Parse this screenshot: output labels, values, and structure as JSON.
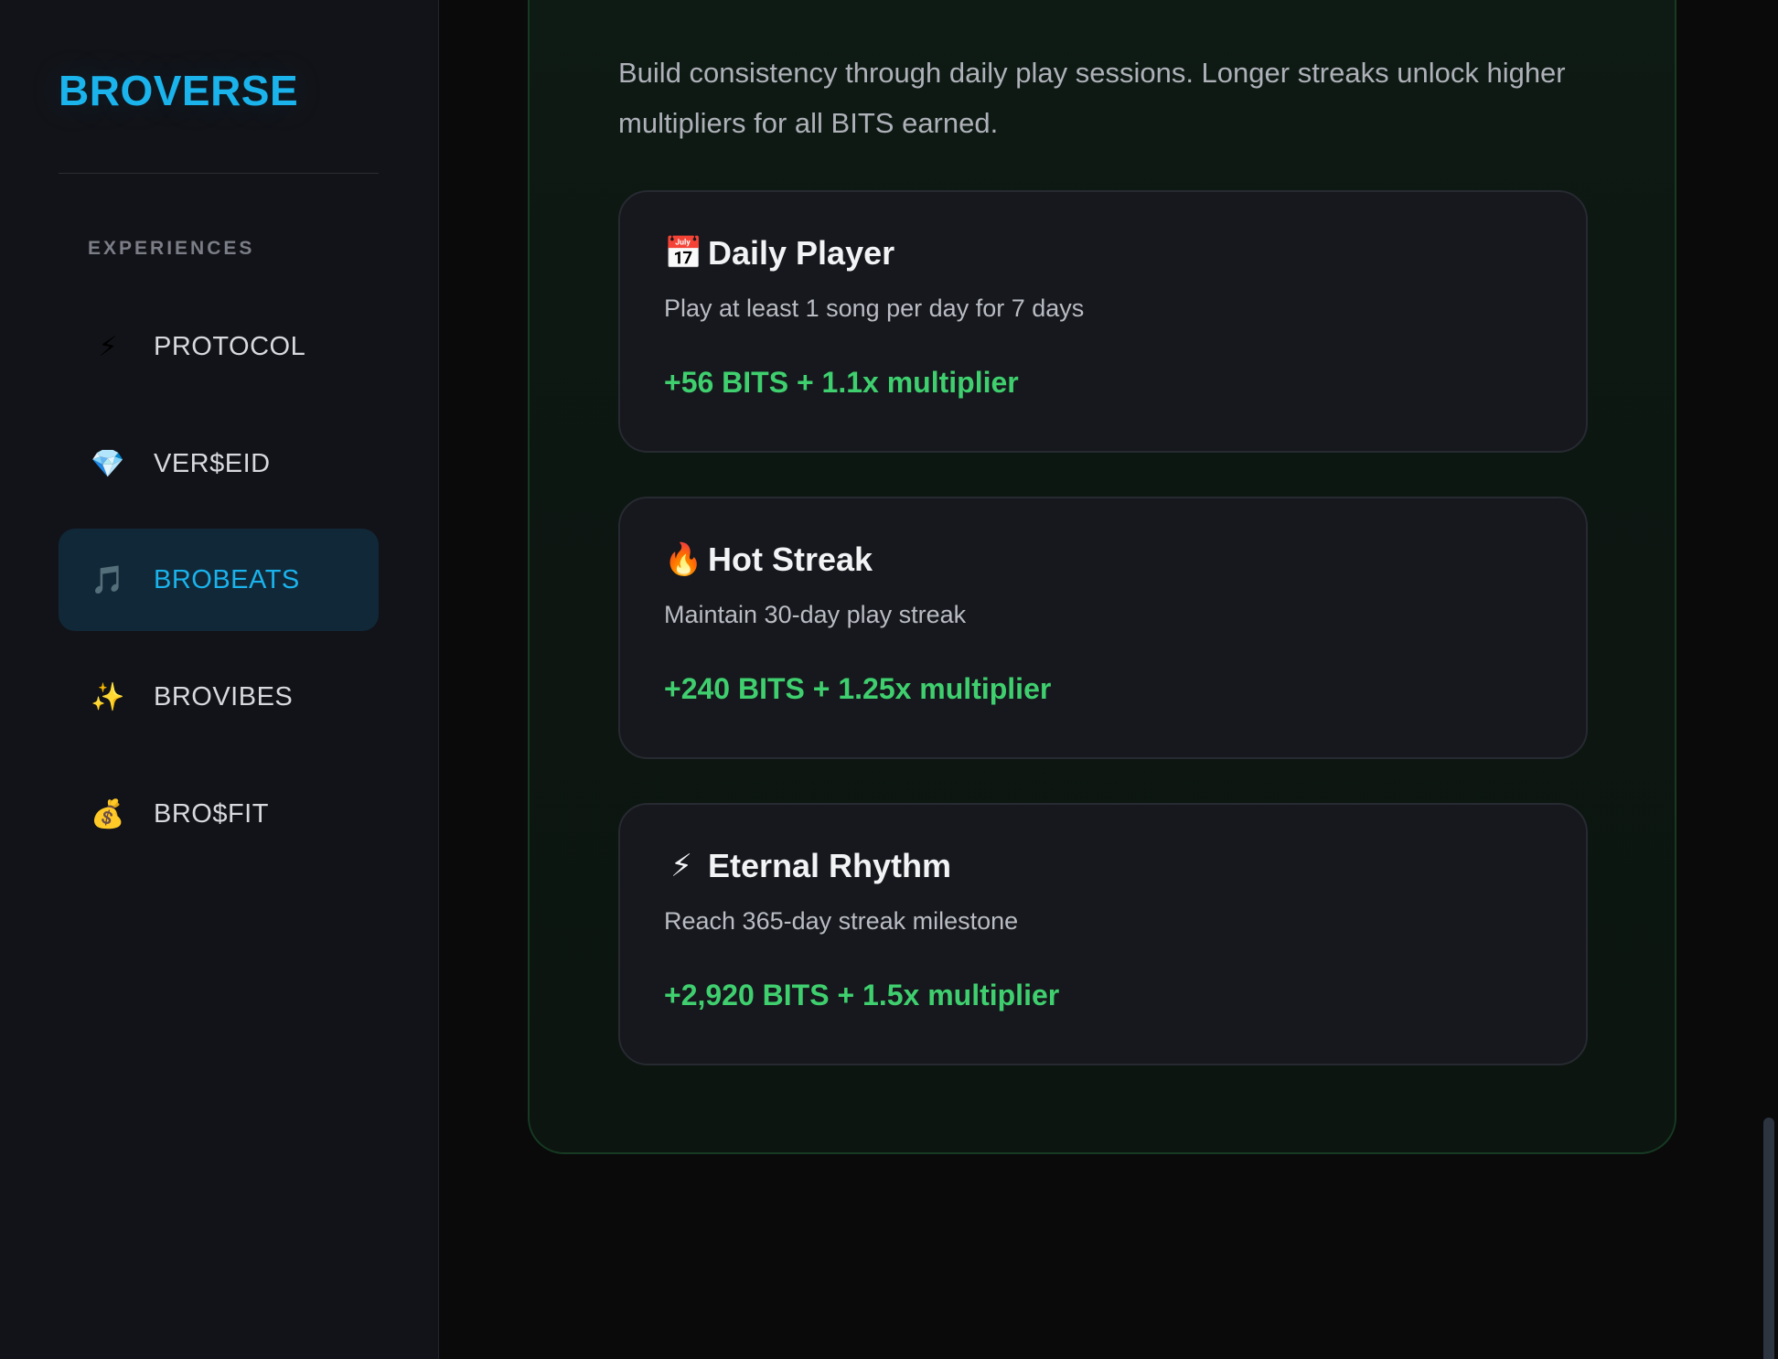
{
  "brand": {
    "name": "BROVERSE"
  },
  "sidebar": {
    "section_label": "EXPERIENCES",
    "items": [
      {
        "icon": "⚡",
        "icon_name": "lightning-icon",
        "label": "PROTOCOL",
        "active": false
      },
      {
        "icon": "💎",
        "icon_name": "gem-icon",
        "label": "VER$EID",
        "active": false
      },
      {
        "icon": "🎵",
        "icon_name": "music-note-icon",
        "label": "BROBEATS",
        "active": true
      },
      {
        "icon": "✨",
        "icon_name": "sparkles-icon",
        "label": "BROVIBES",
        "active": false
      },
      {
        "icon": "💰",
        "icon_name": "money-bag-icon",
        "label": "BRO$FIT",
        "active": false
      }
    ]
  },
  "main": {
    "intro": "Build consistency through daily play sessions. Longer streaks unlock higher multipliers for all BITS earned.",
    "cards": [
      {
        "icon": "📅",
        "icon_name": "calendar-icon",
        "title": "Daily Player",
        "description": "Play at least 1 song per day for 7 days",
        "reward": "+56 BITS + 1.1x multiplier"
      },
      {
        "icon": "🔥",
        "icon_name": "fire-icon",
        "title": "Hot Streak",
        "description": "Maintain 30-day play streak",
        "reward": "+240 BITS + 1.25x multiplier"
      },
      {
        "icon": "⚡",
        "icon_name": "lightning-icon",
        "title": "Eternal Rhythm",
        "description": "Reach 365-day streak milestone",
        "reward": "+2,920 BITS + 1.5x multiplier"
      }
    ]
  },
  "colors": {
    "accent": "#1ab3ec",
    "reward_green": "#3fcf6e",
    "sidebar_bg": "#121318",
    "active_bg": "#112838"
  }
}
